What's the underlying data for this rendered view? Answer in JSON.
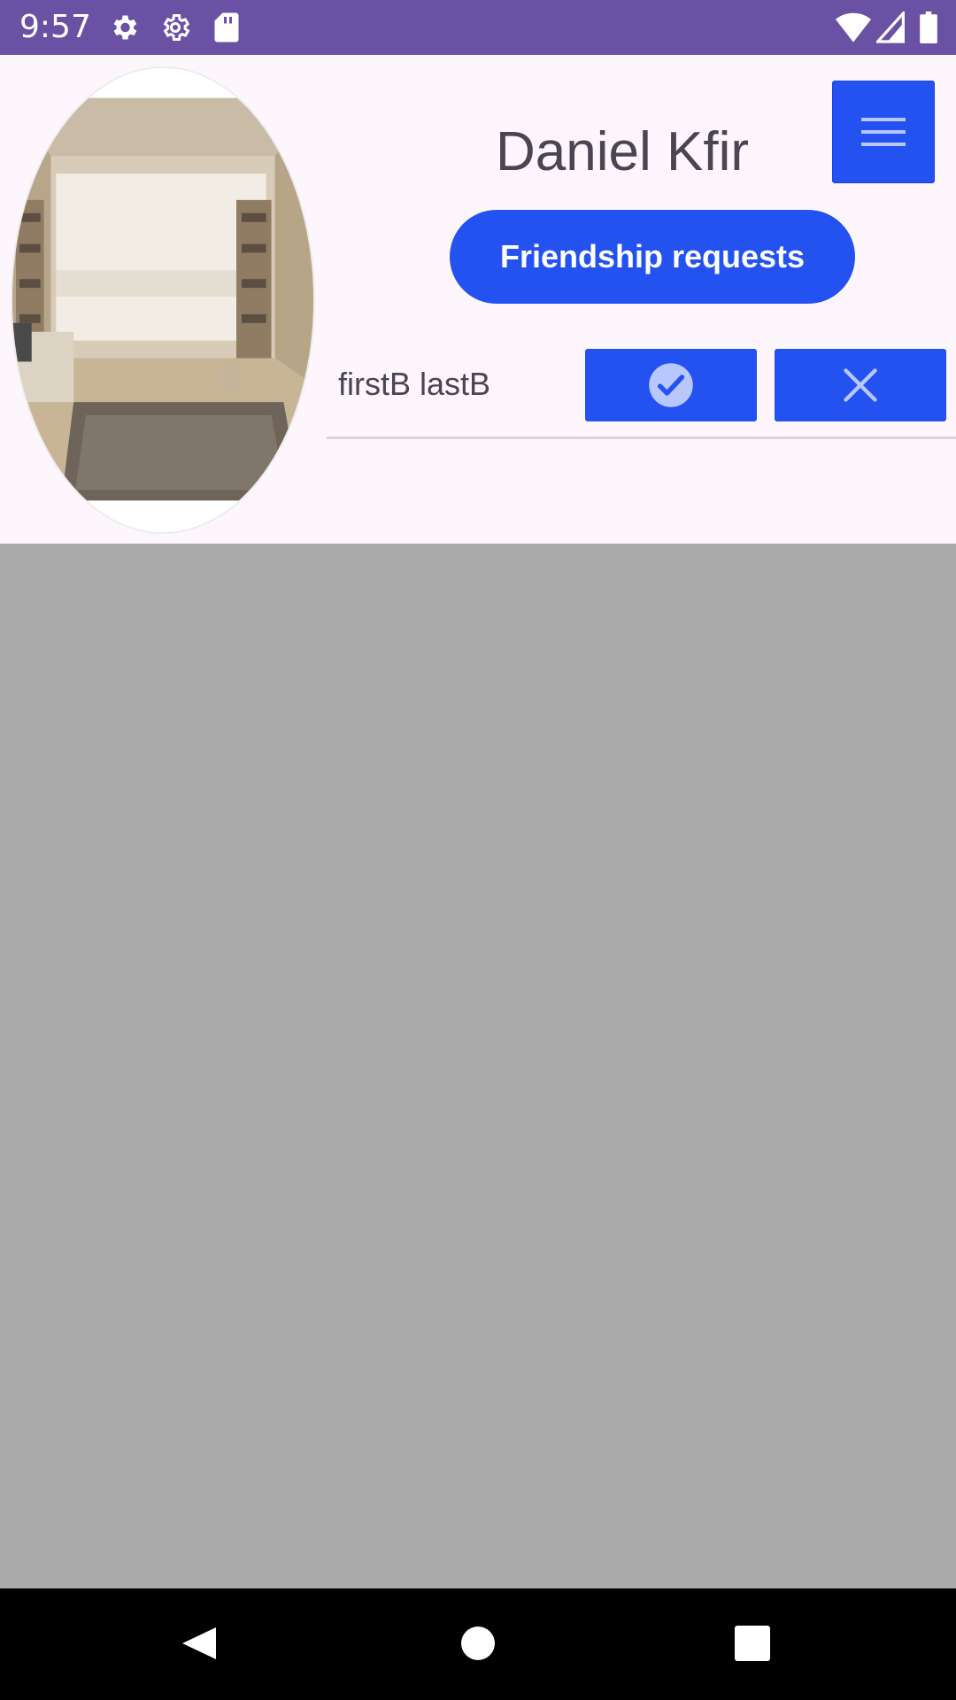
{
  "status_bar": {
    "time": "9:57",
    "icons": [
      "settings-icon",
      "settings-outline-icon",
      "sd-card-icon",
      "wifi-icon",
      "signal-icon",
      "battery-icon"
    ]
  },
  "profile": {
    "name": "Daniel Kfir",
    "avatar": "living-room-photo"
  },
  "menu_button": {
    "icon": "hamburger-menu-icon"
  },
  "friendship_button": {
    "label": "Friendship requests"
  },
  "requests": [
    {
      "name": "firstB lastB",
      "accept_icon": "check-circle-icon",
      "reject_icon": "close-icon"
    }
  ],
  "nav_bar": {
    "buttons": [
      "back-icon",
      "home-icon",
      "recents-icon"
    ]
  },
  "colors": {
    "status_bar": "#6a51a4",
    "accent": "#2352f0",
    "panel_bg": "#fdf6fd",
    "content_bg": "#aaaaaa",
    "text": "#4a4550"
  }
}
